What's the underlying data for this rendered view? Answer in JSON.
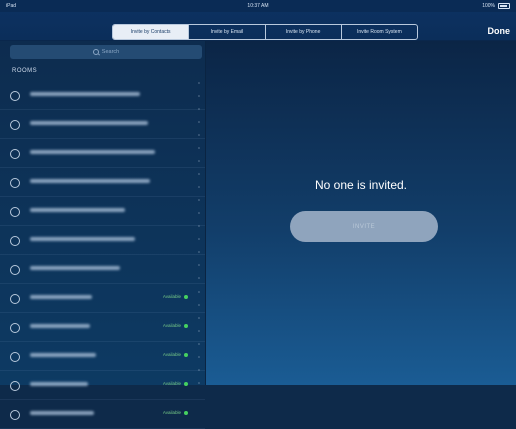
{
  "status_bar": {
    "carrier": "iPad",
    "time": "10:37 AM",
    "battery": "100%"
  },
  "tabs": [
    {
      "label": "Invite by Contacts",
      "selected": true
    },
    {
      "label": "Invite by Email",
      "selected": false
    },
    {
      "label": "Invite by Phone",
      "selected": false
    },
    {
      "label": "Invite Room System",
      "selected": false
    }
  ],
  "done_label": "Done",
  "search": {
    "placeholder": "Search"
  },
  "rooms_header": "ROOMS",
  "rooms": [
    {
      "status": ""
    },
    {
      "status": ""
    },
    {
      "status": ""
    },
    {
      "status": ""
    },
    {
      "status": ""
    },
    {
      "status": ""
    },
    {
      "status": ""
    },
    {
      "status": "Available"
    },
    {
      "status": "Available"
    },
    {
      "status": "Available"
    },
    {
      "status": "Available"
    },
    {
      "status": "Available"
    }
  ],
  "empty_message": "No one is invited.",
  "invite_button": "INVITE",
  "colors": {
    "available": "#46d160",
    "accent": "#0b2e5a"
  },
  "icons": [
    "search-icon",
    "radio-icon",
    "battery-icon",
    "status-dot-icon"
  ]
}
